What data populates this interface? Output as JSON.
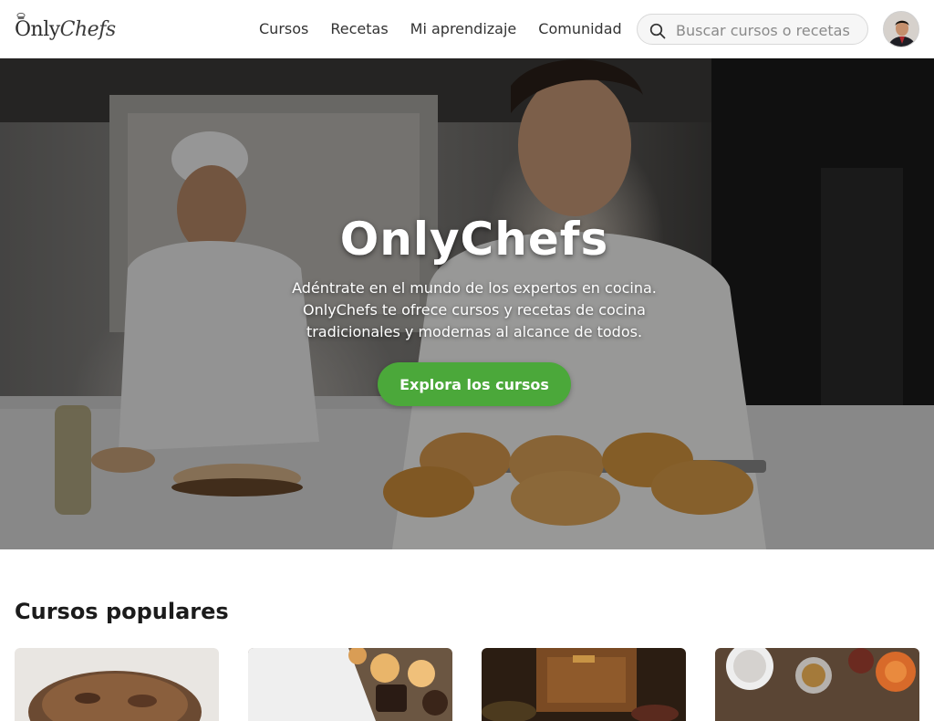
{
  "header": {
    "logo": {
      "text_main": "Only",
      "text_accent": "Chefs"
    },
    "nav": [
      {
        "label": "Cursos"
      },
      {
        "label": "Recetas"
      },
      {
        "label": "Mi aprendizaje"
      },
      {
        "label": "Comunidad"
      }
    ],
    "search": {
      "placeholder": "Buscar cursos o recetas",
      "icon": "search-icon"
    },
    "avatar": {
      "icon": "user-avatar"
    }
  },
  "hero": {
    "title": "OnlyChefs",
    "subtitle": "Adéntrate en el mundo de los expertos en cocina. OnlyChefs te ofrece cursos y recetas de cocina tradicionales y modernas al alcance de todos.",
    "cta_label": "Explora los cursos"
  },
  "popular": {
    "title": "Cursos populares",
    "courses": [
      {
        "thumb": "pie-dessert"
      },
      {
        "thumb": "cookies-pastries"
      },
      {
        "thumb": "rustic-kitchen"
      },
      {
        "thumb": "tea-and-spices"
      }
    ]
  },
  "colors": {
    "accent": "#4ba83a",
    "text": "#222222",
    "header_bg": "#ffffff"
  }
}
